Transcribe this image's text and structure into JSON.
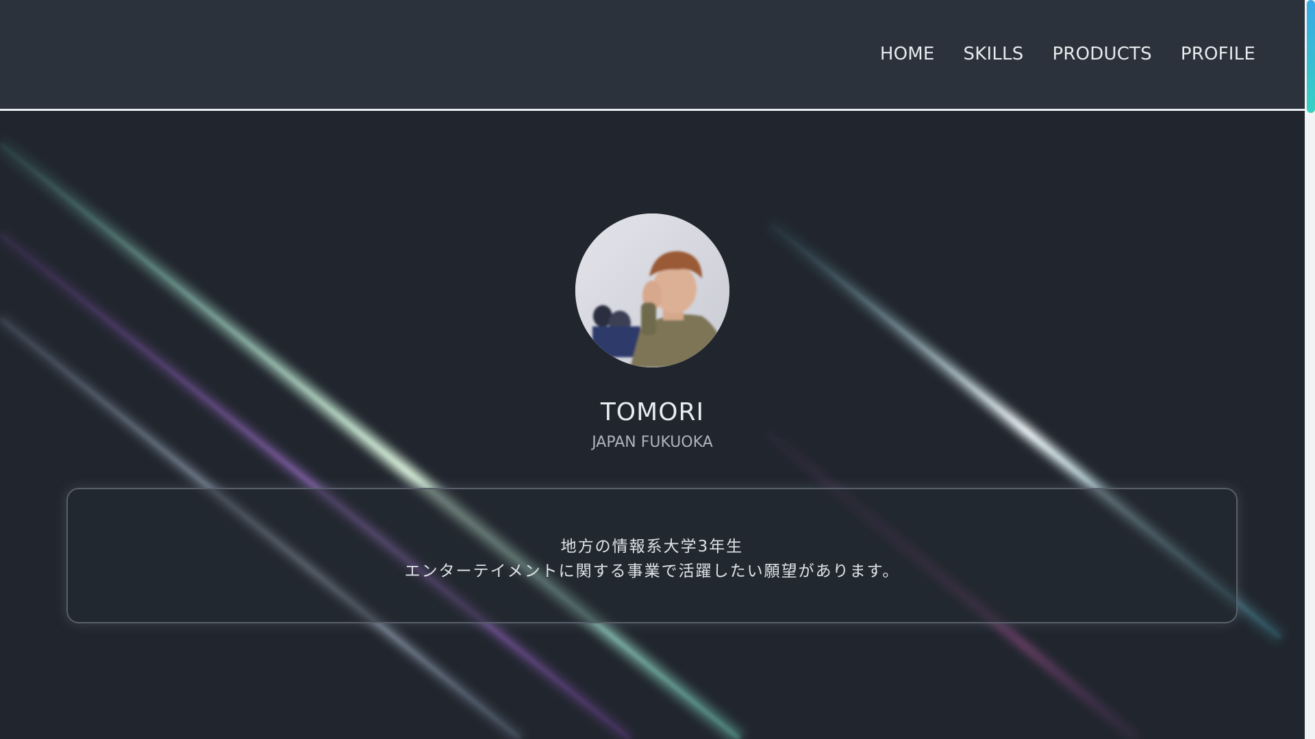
{
  "nav": {
    "items": [
      {
        "label": "HOME"
      },
      {
        "label": "SKILLS"
      },
      {
        "label": "PRODUCTS"
      },
      {
        "label": "PROFILE"
      }
    ]
  },
  "profile": {
    "name": "TOMORI",
    "location": "JAPAN FUKUOKA",
    "avatar_icon": "profile-photo"
  },
  "bio": {
    "line1": "地方の情報系大学3年生",
    "line2": "エンターテイメントに関する事業で活躍したい願望があります。"
  },
  "colors": {
    "background": "#21262e",
    "header": "#2c323b",
    "header_border": "#e8eef2",
    "scroll_thumb_top": "#3aa7e6",
    "scroll_thumb_bottom": "#37d1c2",
    "beam_teal": "#8fd6c8",
    "beam_purple": "#8a5cc4",
    "beam_steel": "#9aa8bb"
  }
}
